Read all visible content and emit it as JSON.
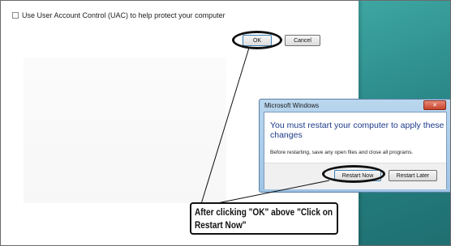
{
  "main_dialog": {
    "uac_checkbox_label": "Use User Account Control (UAC) to help protect your computer",
    "uac_checked": false,
    "ok_label": "OK",
    "cancel_label": "Cancel"
  },
  "restart_dialog": {
    "title": "Microsoft Windows",
    "close_glyph": "✕",
    "heading": "You must restart your computer to apply these changes",
    "note": "Before restarting, save any open files and close all programs.",
    "restart_now_label": "Restart Now",
    "restart_later_label": "Restart Later"
  },
  "annotation": {
    "callout_line1": "After clicking \"OK\" above \"Click on",
    "callout_line2": "Restart Now\""
  },
  "colors": {
    "desktop": "#2c8c8b",
    "dialog_frame": "#a8c9e8",
    "heading_text": "#1e3b8a",
    "annotation": "#111111"
  }
}
